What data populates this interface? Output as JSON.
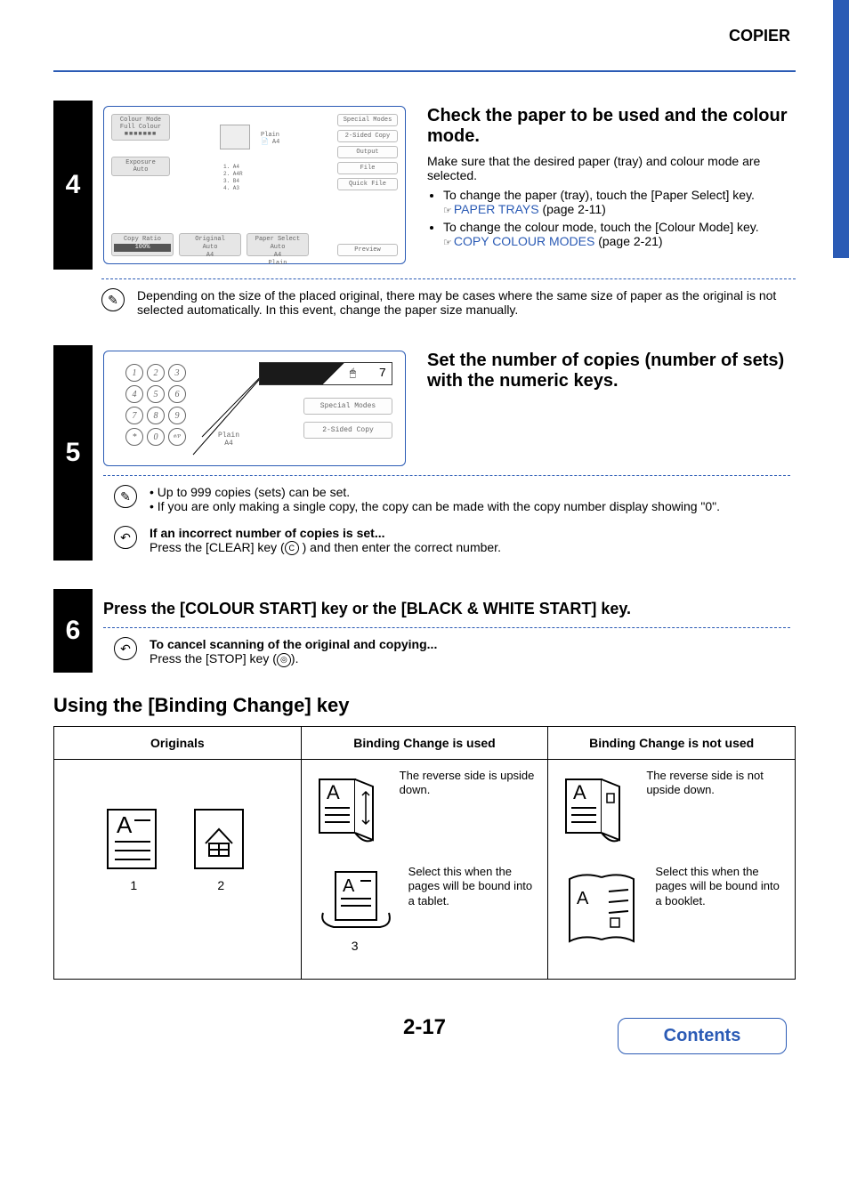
{
  "header": {
    "section": "COPIER"
  },
  "step4": {
    "num": "4",
    "title": "Check the paper to be used and the colour mode.",
    "desc": "Make sure that the desired paper (tray) and colour mode are selected.",
    "bul1": "To change the paper (tray), touch the [Paper Select] key.",
    "link1": "PAPER TRAYS",
    "link1_suffix": " (page 2-11)",
    "bul2": "To change the colour mode, touch the [Colour Mode] key.",
    "link2": "COPY COLOUR MODES",
    "link2_suffix": " (page 2-21)",
    "note": "Depending on the size of the placed original, there may be cases where the same size of paper as the original is not selected automatically. In this event, change the paper size manually.",
    "panel": {
      "colour_mode": "Colour Mode",
      "full_colour": "Full Colour",
      "exposure": "Exposure",
      "auto": "Auto",
      "plain": "Plain",
      "a4": "A4",
      "trays_1": "1.   A4",
      "trays_2": "2.  A4R",
      "trays_3": "3.   B4",
      "trays_4": "4.   A3",
      "special_modes": "Special Modes",
      "two_sided": "2-Sided Copy",
      "output": "Output",
      "file": "File",
      "quick_file": "Quick File",
      "copy_ratio": "Copy Ratio",
      "ratio_val": "100%",
      "original": "Original",
      "original_auto": "Auto",
      "original_a4": "A4",
      "paper_select": "Paper Select",
      "ps_auto": "Auto",
      "ps_a4": "A4",
      "ps_plain": "Plain",
      "preview": "Preview"
    }
  },
  "step5": {
    "num": "5",
    "title": "Set the number of copies (number of sets) with the numeric keys.",
    "note_a": "Up to 999 copies (sets) can be set.",
    "note_b": "If you are only making a single copy, the copy can be made with the copy number display showing \"0\".",
    "cancel_h": "If an incorrect number of copies is set...",
    "cancel_t_pre": "Press the [CLEAR] key (",
    "cancel_key": "C",
    "cancel_t_post": " ) and then enter the correct number.",
    "panel": {
      "display_val": "7",
      "special_modes": "Special Modes",
      "two_sided": "2-Sided Copy",
      "plain": "Plain",
      "a4": "A4",
      "keys": [
        "1",
        "2",
        "3",
        "4",
        "5",
        "6",
        "7",
        "8",
        "9",
        "*",
        "0",
        "#/P"
      ]
    }
  },
  "step6": {
    "num": "6",
    "title": "Press the [COLOUR START] key or the [BLACK & WHITE START] key.",
    "cancel_h": "To cancel scanning of the original and copying...",
    "cancel_t_pre": "Press the [STOP] key (",
    "cancel_key": "◎",
    "cancel_t_post": ")."
  },
  "binding": {
    "heading": "Using the [Binding Change] key",
    "col1": "Originals",
    "col2": "Binding Change is used",
    "col3": "Binding Change is not used",
    "orig_label1": "1",
    "orig_label2": "2",
    "used_a": "The reverse side is upside down.",
    "used_b": "Select this when the pages will be bound into a tablet.",
    "used_b_num": "3",
    "notused_a": "The reverse side is not upside down.",
    "notused_b": "Select this when the pages will be bound into a booklet."
  },
  "footer": {
    "page": "2-17",
    "contents": "Contents"
  }
}
